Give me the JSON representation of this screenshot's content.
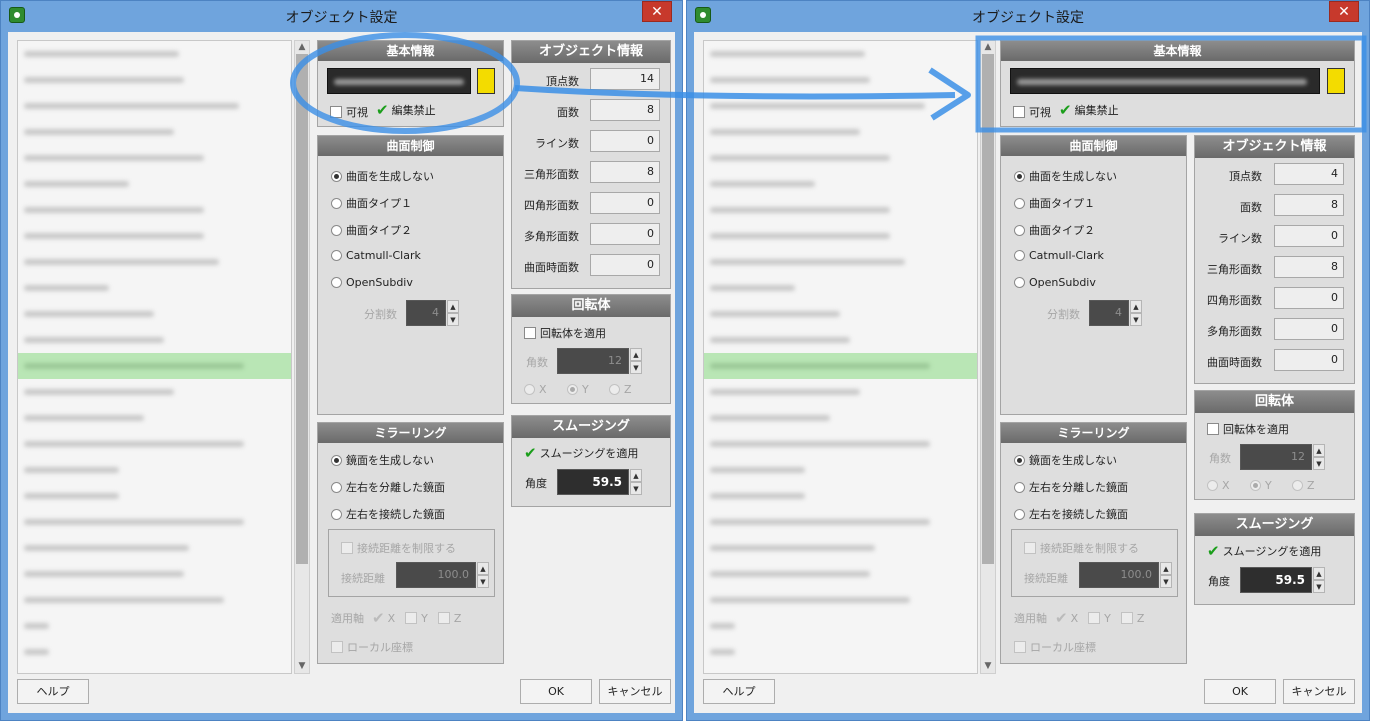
{
  "windows": [
    {
      "title": "オブジェクト設定",
      "close": "✕"
    },
    {
      "title": "オブジェクト設定",
      "close": "✕"
    }
  ],
  "basic_info": {
    "header": "基本情報",
    "visible": "可視",
    "edit_lock": "編集禁止"
  },
  "surface": {
    "header": "曲面制御",
    "options": [
      "曲面を生成しない",
      "曲面タイプ１",
      "曲面タイプ２",
      "Catmull-Clark",
      "OpenSubdiv"
    ],
    "subdiv_label": "分割数",
    "subdiv_value": "4"
  },
  "mirror": {
    "header": "ミラーリング",
    "options": [
      "鏡面を生成しない",
      "左右を分離した鏡面",
      "左右を接続した鏡面"
    ],
    "limit": "接続距離を制限する",
    "dist_label": "接続距離",
    "dist_value": "100.0",
    "axis_label": "適用軸",
    "x": "X",
    "y": "Y",
    "z": "Z",
    "local": "ローカル座標"
  },
  "object_info": {
    "header": "オブジェクト情報",
    "labels": [
      "頂点数",
      "面数",
      "ライン数",
      "三角形面数",
      "四角形面数",
      "多角形面数",
      "曲面時面数"
    ],
    "values_w1": [
      "14",
      "8",
      "0",
      "8",
      "0",
      "0",
      "0"
    ],
    "values_w2": [
      "4",
      "8",
      "0",
      "8",
      "0",
      "0",
      "0"
    ]
  },
  "lathe": {
    "header": "回転体",
    "apply": "回転体を適用",
    "angle_label": "角数",
    "angle_value": "12",
    "x": "X",
    "y": "Y",
    "z": "Z"
  },
  "smoothing": {
    "header": "スムージング",
    "apply": "スムージングを適用",
    "angle_label": "角度",
    "angle_value": "59.5"
  },
  "buttons": {
    "help": "ヘルプ",
    "ok": "OK",
    "cancel": "キャンセル"
  },
  "colors": {
    "swatch": "#f3dc00",
    "annotation": "#3b8fe6",
    "selection": "#b9e6b5"
  }
}
